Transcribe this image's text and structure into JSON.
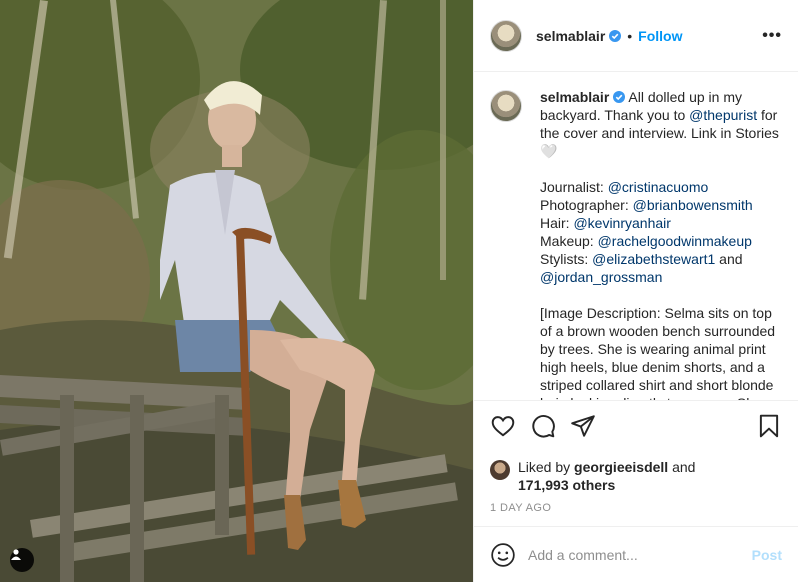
{
  "header": {
    "username": "selmablair",
    "separator": "•",
    "follow_label": "Follow",
    "more_label": "•••"
  },
  "caption": {
    "username": "selmablair",
    "text_parts": {
      "intro": "All dolled up in my backyard. Thank you to ",
      "purist": "@thepurist",
      "intro_end": " for the cover and interview. Link in Stories ",
      "heart": "🤍"
    },
    "credits": [
      {
        "role": "Journalist: ",
        "handle": "@cristinacuomo"
      },
      {
        "role": "Photographer: ",
        "handle": "@brianbowensmith"
      },
      {
        "role": "Hair: ",
        "handle": "@kevinryanhair"
      },
      {
        "role": "Makeup: ",
        "handle": "@rachelgoodwinmakeup"
      },
      {
        "role": "Stylists: ",
        "handle": "@elizabethstewart1"
      }
    ],
    "stylists_and": " and",
    "last_handle": "@jordan_grossman",
    "image_description": "[Image Description: Selma sits on top of a brown wooden bench surrounded by trees. She is wearing animal print high heels, blue denim shorts, and a striped collared shirt and short blonde hair, looking directly to camera. She holds a carved wooden cane to the"
  },
  "actions": {
    "icons": [
      "heart-icon",
      "comment-icon",
      "share-icon",
      "bookmark-icon"
    ]
  },
  "likes": {
    "prefix": "Liked by ",
    "user": "georgieeisdell",
    "and": " and",
    "count": "171,993 others"
  },
  "timestamp": "1 day ago",
  "comment": {
    "placeholder": "Add a comment...",
    "post_label": "Post"
  },
  "colors": {
    "accent": "#0095f6",
    "mention": "#00376b",
    "post_disabled": "#b2dffc",
    "muted": "#8e8e8e"
  }
}
